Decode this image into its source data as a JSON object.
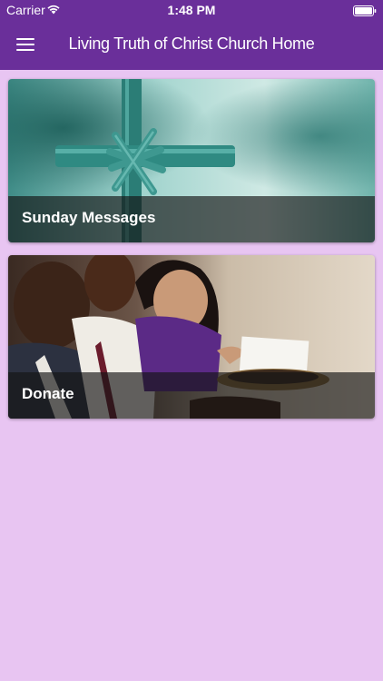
{
  "status_bar": {
    "carrier": "Carrier",
    "time": "1:48 PM"
  },
  "header": {
    "title": "Living Truth of Christ Church Home",
    "menu_icon": "hamburger-menu-icon",
    "background_color": "#6a2f9a"
  },
  "page": {
    "background_color": "#e8c5f2"
  },
  "cards": [
    {
      "label": "Sunday Messages",
      "image": "palm-cross-photo"
    },
    {
      "label": "Donate",
      "image": "offering-plate-photo"
    }
  ]
}
